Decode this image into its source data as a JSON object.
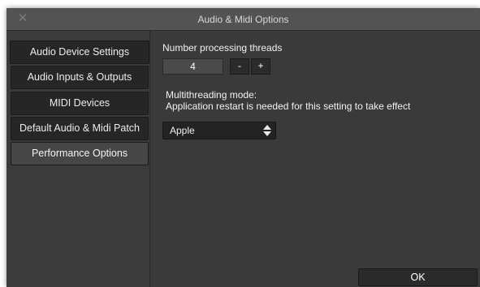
{
  "window": {
    "title": "Audio & Midi Options",
    "close_glyph": "✕",
    "close_icon": "close-icon"
  },
  "sidebar": {
    "items": [
      {
        "label": "Audio Device Settings",
        "active": false
      },
      {
        "label": "Audio Inputs & Outputs",
        "active": false
      },
      {
        "label": "MIDI Devices",
        "active": false
      },
      {
        "label": "Default Audio & Midi Patch",
        "active": false
      },
      {
        "label": "Performance Options",
        "active": true
      }
    ]
  },
  "performance": {
    "threads_label": "Number processing threads",
    "threads_value": "4",
    "decrement_label": "-",
    "increment_label": "+",
    "mode_label": "Multithreading mode:",
    "mode_note": "Application restart is needed for this setting to take effect",
    "mode_value": "Apple",
    "mode_icon": "up-down-arrows-icon"
  },
  "footer": {
    "ok_label": "OK"
  },
  "colors": {
    "window_bg": "#3a3a3a",
    "titlebar_bg": "#535353",
    "sidebar_item_bg": "#262626",
    "sidebar_item_active_bg": "#464646",
    "text": "#f2f2f2"
  }
}
